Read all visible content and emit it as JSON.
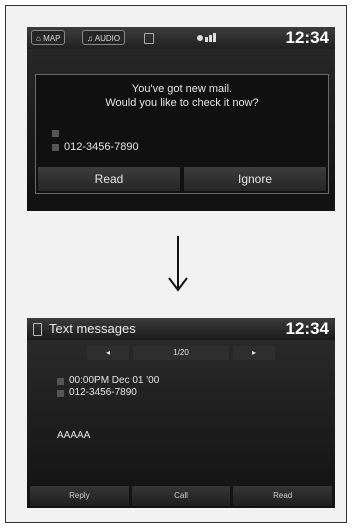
{
  "screen1": {
    "tabs": {
      "map": "MAP",
      "audio": "AUDIO"
    },
    "clock": "12:34",
    "dialog": {
      "line1": "You've got new mail.",
      "line2": "Would you like to check it now?",
      "phone": "012-3456-7890",
      "buttons": {
        "read": "Read",
        "ignore": "Ignore"
      }
    }
  },
  "screen2": {
    "title": "Text messages",
    "clock": "12:34",
    "page": "1/20",
    "prev": "◂",
    "next": "▸",
    "datetime": "00:00PM Dec 01 '00",
    "phone": "012-3456-7890",
    "body": "AAAAA",
    "buttons": {
      "reply": "Reply",
      "call": "Call",
      "read": "Read"
    }
  }
}
